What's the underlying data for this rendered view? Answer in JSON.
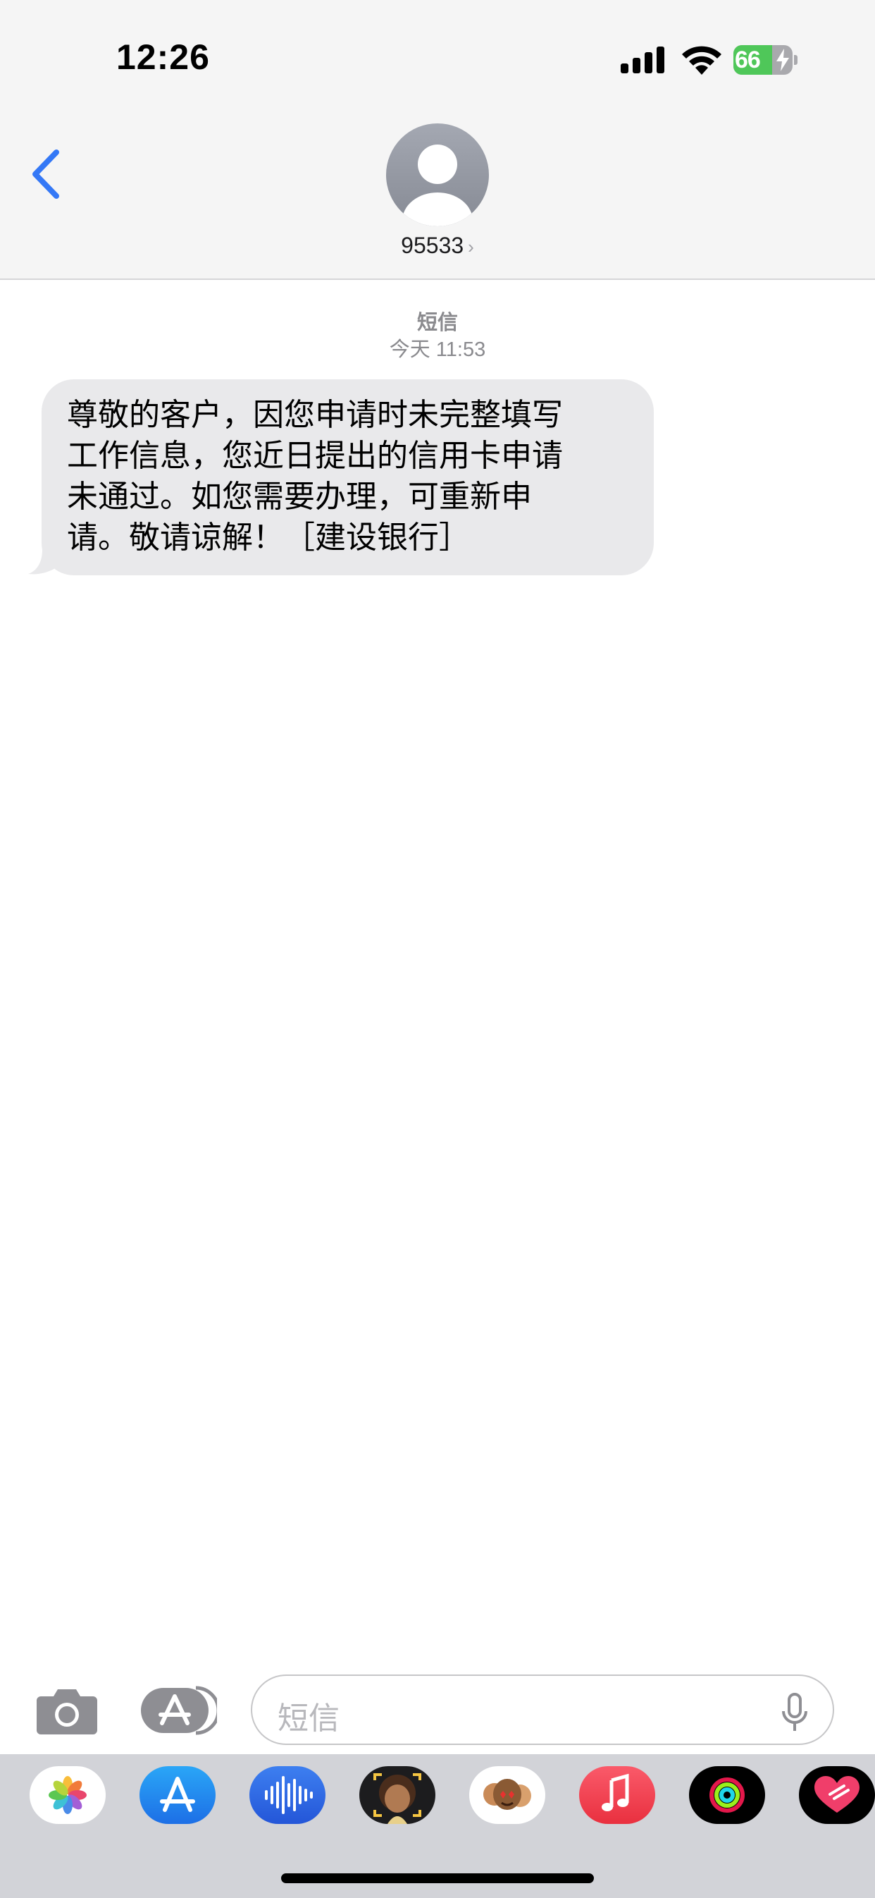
{
  "status_bar": {
    "time": "12:26",
    "battery": "66"
  },
  "header": {
    "contact": "95533",
    "contact_chevron": "›"
  },
  "thread": {
    "service_label": "短信",
    "timestamp": "今天 11:53",
    "messages": [
      {
        "direction": "incoming",
        "lines": [
          "尊敬的客户，因您申请时未完整填写",
          "工作信息，您近日提出的信用卡申请",
          "未通过。如您需要办理，可重新申",
          "请。敬请谅解！［建设银行］"
        ]
      }
    ]
  },
  "composer": {
    "placeholder": "短信"
  },
  "app_drawer": [
    {
      "icon": "photos-icon"
    },
    {
      "icon": "app-store-icon"
    },
    {
      "icon": "audio-message-icon"
    },
    {
      "icon": "memoji-icon"
    },
    {
      "icon": "memoji-stickers-icon"
    },
    {
      "icon": "music-icon"
    },
    {
      "icon": "activity-icon"
    },
    {
      "icon": "digital-touch-icon"
    }
  ],
  "colors": {
    "accent": "#3478f6",
    "bubble_incoming": "#e9e9eb",
    "battery_fill": "#4fc759"
  }
}
